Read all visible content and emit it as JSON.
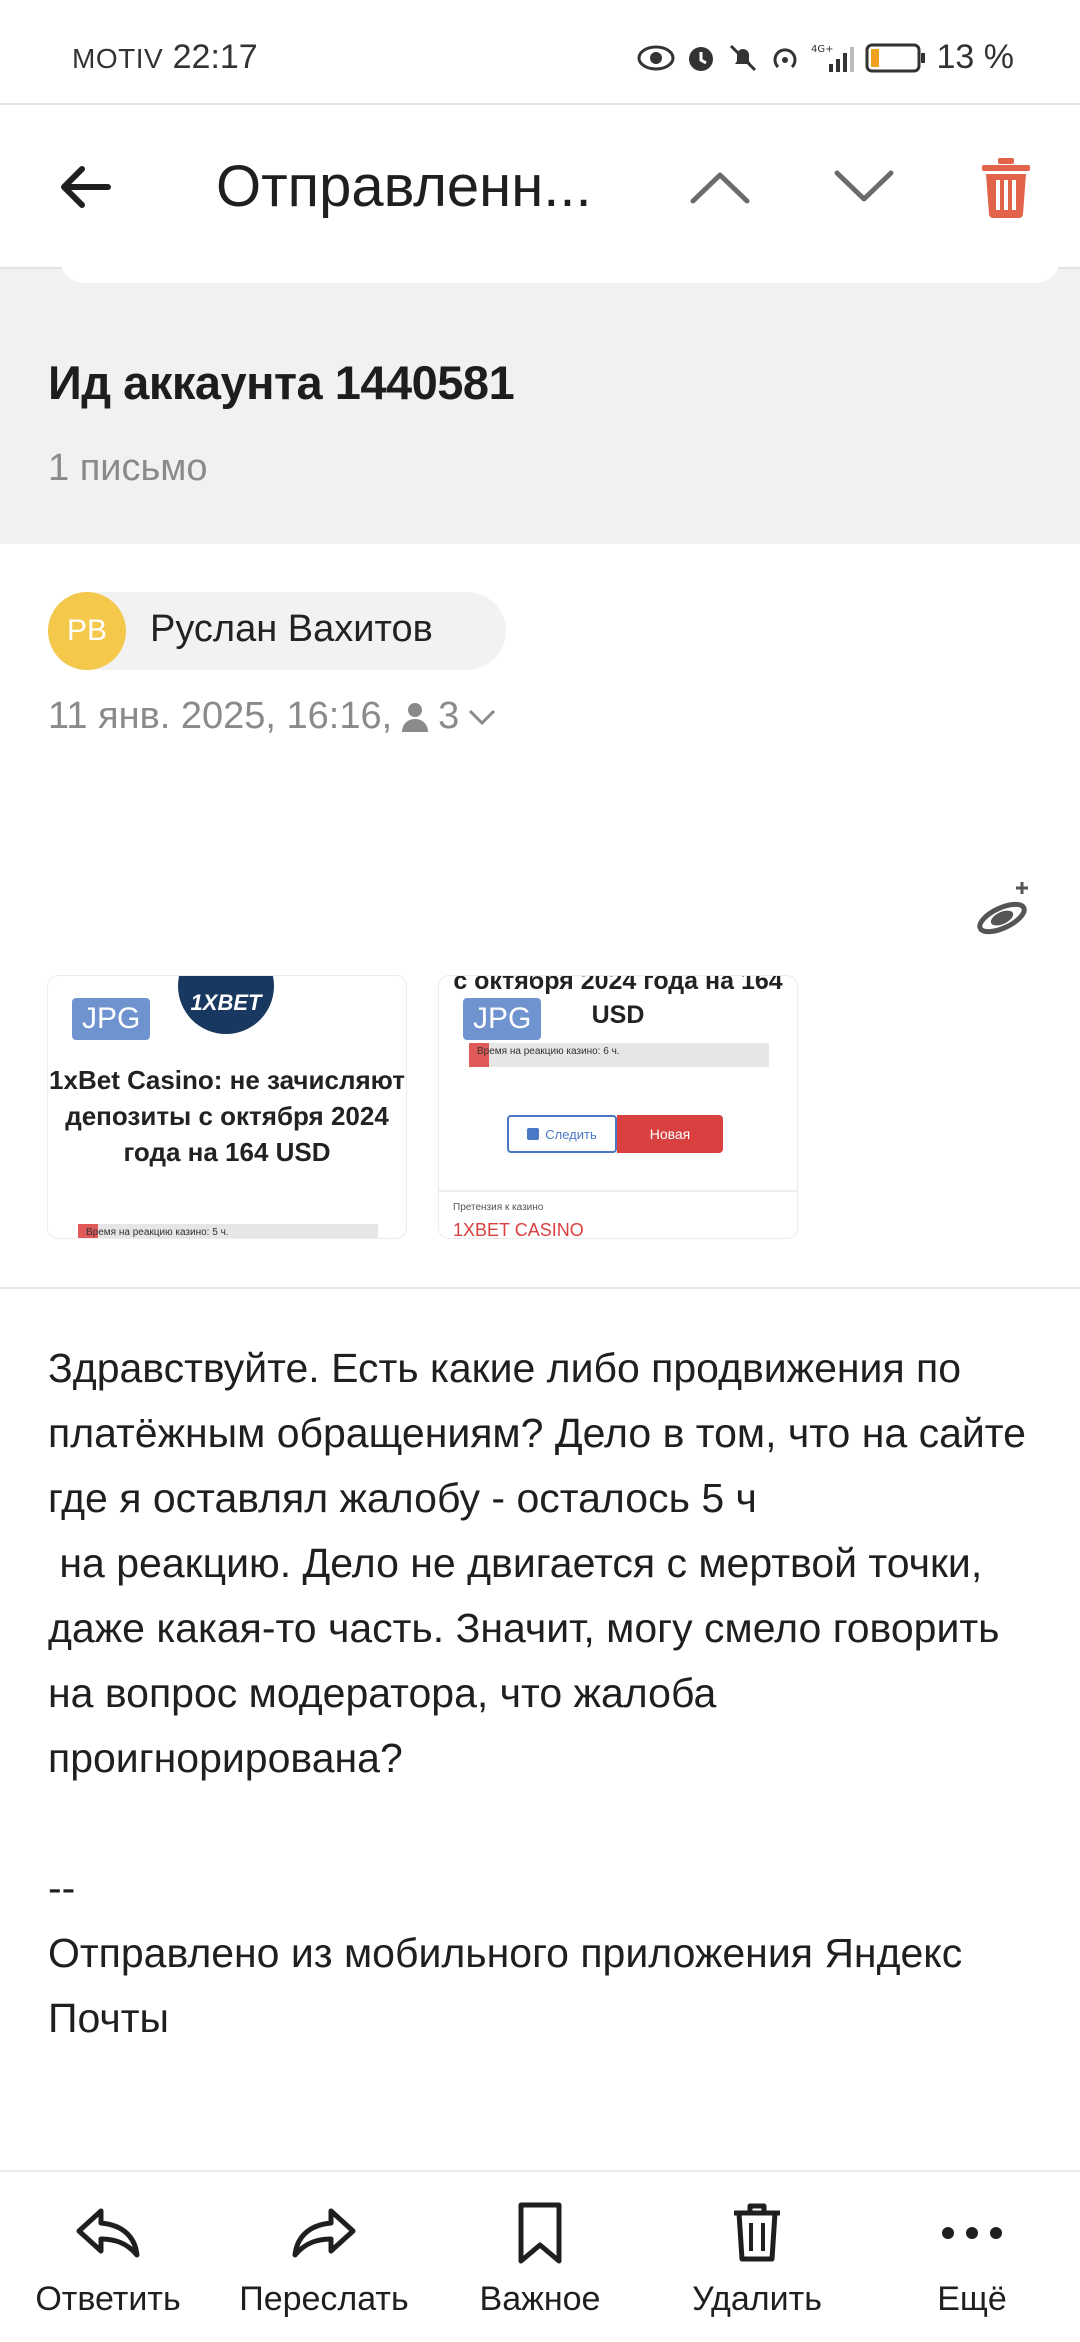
{
  "status_bar": {
    "carrier": "MOTIV",
    "time": "22:17",
    "battery": "13 %",
    "icons": [
      "eye-icon",
      "alarm-icon",
      "mute-icon",
      "hotspot-icon",
      "signal-icon",
      "battery-icon"
    ]
  },
  "toolbar": {
    "title": "Отправленн...",
    "icons": {
      "back": "back-arrow-icon",
      "prev": "chevron-up-icon",
      "next": "chevron-down-icon",
      "delete": "trash-icon"
    },
    "delete_color": "#e0634a"
  },
  "thread": {
    "title": "Ид аккаунта 1440581",
    "count": "1 письмо"
  },
  "message": {
    "avatar_initials": "РВ",
    "avatar_color": "#f4c84a",
    "sender": "Руслан Вахитов",
    "datetime": "11 янв. 2025, 16:16,",
    "recipients_count": "3",
    "attachments": [
      {
        "type": "JPG",
        "logo": "1XBET",
        "text": "1xBet Casino: не зачисляют депозиты с октября 2024 года на 164 USD",
        "bar_text": "Время на реакцию казино: 5 ч."
      },
      {
        "type": "JPG",
        "text": "с октября 2024 года на 164 USD",
        "bar_text": "Время на реакцию казино: 6 ч.",
        "follow": "Следить",
        "new": "Новая",
        "claim_label": "Претензия к казино",
        "claim_name": "1XBET CASINO"
      }
    ],
    "body": "Здравствуйте. Есть какие либо продвижения по платёжным обращениям? Дело в том, что на сайте где я оставлял жалобу - осталось 5 ч\n на реакцию. Дело не двигается с мертвой точки, даже какая-то часть. Значит, могу смело говорить на вопрос модератора, что жалоба проигнорирована?\n\n--\nОтправлено из мобильного приложения Яндекс Почты"
  },
  "bottom_bar": {
    "items": [
      {
        "label": "Ответить",
        "icon": "reply-icon"
      },
      {
        "label": "Переслать",
        "icon": "forward-icon"
      },
      {
        "label": "Важное",
        "icon": "bookmark-icon"
      },
      {
        "label": "Удалить",
        "icon": "trash-icon"
      },
      {
        "label": "Ещё",
        "icon": "more-icon"
      }
    ]
  }
}
